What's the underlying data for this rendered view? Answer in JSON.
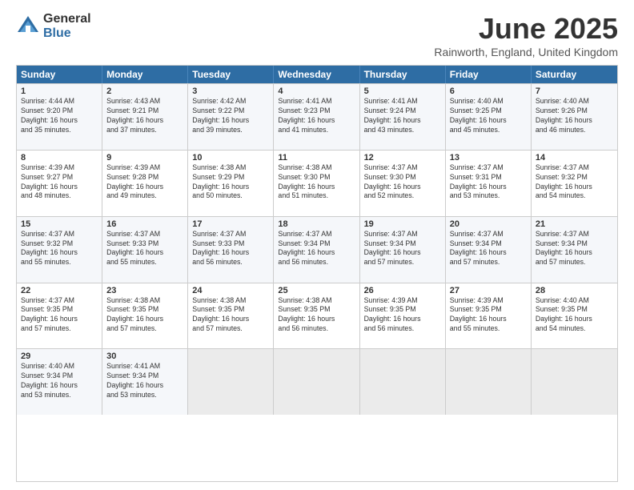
{
  "header": {
    "logo_general": "General",
    "logo_blue": "Blue",
    "month_title": "June 2025",
    "location": "Rainworth, England, United Kingdom"
  },
  "days_of_week": [
    "Sunday",
    "Monday",
    "Tuesday",
    "Wednesday",
    "Thursday",
    "Friday",
    "Saturday"
  ],
  "weeks": [
    [
      {
        "day": "1",
        "info": "Sunrise: 4:44 AM\nSunset: 9:20 PM\nDaylight: 16 hours\nand 35 minutes."
      },
      {
        "day": "2",
        "info": "Sunrise: 4:43 AM\nSunset: 9:21 PM\nDaylight: 16 hours\nand 37 minutes."
      },
      {
        "day": "3",
        "info": "Sunrise: 4:42 AM\nSunset: 9:22 PM\nDaylight: 16 hours\nand 39 minutes."
      },
      {
        "day": "4",
        "info": "Sunrise: 4:41 AM\nSunset: 9:23 PM\nDaylight: 16 hours\nand 41 minutes."
      },
      {
        "day": "5",
        "info": "Sunrise: 4:41 AM\nSunset: 9:24 PM\nDaylight: 16 hours\nand 43 minutes."
      },
      {
        "day": "6",
        "info": "Sunrise: 4:40 AM\nSunset: 9:25 PM\nDaylight: 16 hours\nand 45 minutes."
      },
      {
        "day": "7",
        "info": "Sunrise: 4:40 AM\nSunset: 9:26 PM\nDaylight: 16 hours\nand 46 minutes."
      }
    ],
    [
      {
        "day": "8",
        "info": "Sunrise: 4:39 AM\nSunset: 9:27 PM\nDaylight: 16 hours\nand 48 minutes."
      },
      {
        "day": "9",
        "info": "Sunrise: 4:39 AM\nSunset: 9:28 PM\nDaylight: 16 hours\nand 49 minutes."
      },
      {
        "day": "10",
        "info": "Sunrise: 4:38 AM\nSunset: 9:29 PM\nDaylight: 16 hours\nand 50 minutes."
      },
      {
        "day": "11",
        "info": "Sunrise: 4:38 AM\nSunset: 9:30 PM\nDaylight: 16 hours\nand 51 minutes."
      },
      {
        "day": "12",
        "info": "Sunrise: 4:37 AM\nSunset: 9:30 PM\nDaylight: 16 hours\nand 52 minutes."
      },
      {
        "day": "13",
        "info": "Sunrise: 4:37 AM\nSunset: 9:31 PM\nDaylight: 16 hours\nand 53 minutes."
      },
      {
        "day": "14",
        "info": "Sunrise: 4:37 AM\nSunset: 9:32 PM\nDaylight: 16 hours\nand 54 minutes."
      }
    ],
    [
      {
        "day": "15",
        "info": "Sunrise: 4:37 AM\nSunset: 9:32 PM\nDaylight: 16 hours\nand 55 minutes."
      },
      {
        "day": "16",
        "info": "Sunrise: 4:37 AM\nSunset: 9:33 PM\nDaylight: 16 hours\nand 55 minutes."
      },
      {
        "day": "17",
        "info": "Sunrise: 4:37 AM\nSunset: 9:33 PM\nDaylight: 16 hours\nand 56 minutes."
      },
      {
        "day": "18",
        "info": "Sunrise: 4:37 AM\nSunset: 9:34 PM\nDaylight: 16 hours\nand 56 minutes."
      },
      {
        "day": "19",
        "info": "Sunrise: 4:37 AM\nSunset: 9:34 PM\nDaylight: 16 hours\nand 57 minutes."
      },
      {
        "day": "20",
        "info": "Sunrise: 4:37 AM\nSunset: 9:34 PM\nDaylight: 16 hours\nand 57 minutes."
      },
      {
        "day": "21",
        "info": "Sunrise: 4:37 AM\nSunset: 9:34 PM\nDaylight: 16 hours\nand 57 minutes."
      }
    ],
    [
      {
        "day": "22",
        "info": "Sunrise: 4:37 AM\nSunset: 9:35 PM\nDaylight: 16 hours\nand 57 minutes."
      },
      {
        "day": "23",
        "info": "Sunrise: 4:38 AM\nSunset: 9:35 PM\nDaylight: 16 hours\nand 57 minutes."
      },
      {
        "day": "24",
        "info": "Sunrise: 4:38 AM\nSunset: 9:35 PM\nDaylight: 16 hours\nand 57 minutes."
      },
      {
        "day": "25",
        "info": "Sunrise: 4:38 AM\nSunset: 9:35 PM\nDaylight: 16 hours\nand 56 minutes."
      },
      {
        "day": "26",
        "info": "Sunrise: 4:39 AM\nSunset: 9:35 PM\nDaylight: 16 hours\nand 56 minutes."
      },
      {
        "day": "27",
        "info": "Sunrise: 4:39 AM\nSunset: 9:35 PM\nDaylight: 16 hours\nand 55 minutes."
      },
      {
        "day": "28",
        "info": "Sunrise: 4:40 AM\nSunset: 9:35 PM\nDaylight: 16 hours\nand 54 minutes."
      }
    ],
    [
      {
        "day": "29",
        "info": "Sunrise: 4:40 AM\nSunset: 9:34 PM\nDaylight: 16 hours\nand 53 minutes."
      },
      {
        "day": "30",
        "info": "Sunrise: 4:41 AM\nSunset: 9:34 PM\nDaylight: 16 hours\nand 53 minutes."
      },
      {
        "day": "",
        "info": ""
      },
      {
        "day": "",
        "info": ""
      },
      {
        "day": "",
        "info": ""
      },
      {
        "day": "",
        "info": ""
      },
      {
        "day": "",
        "info": ""
      }
    ]
  ]
}
